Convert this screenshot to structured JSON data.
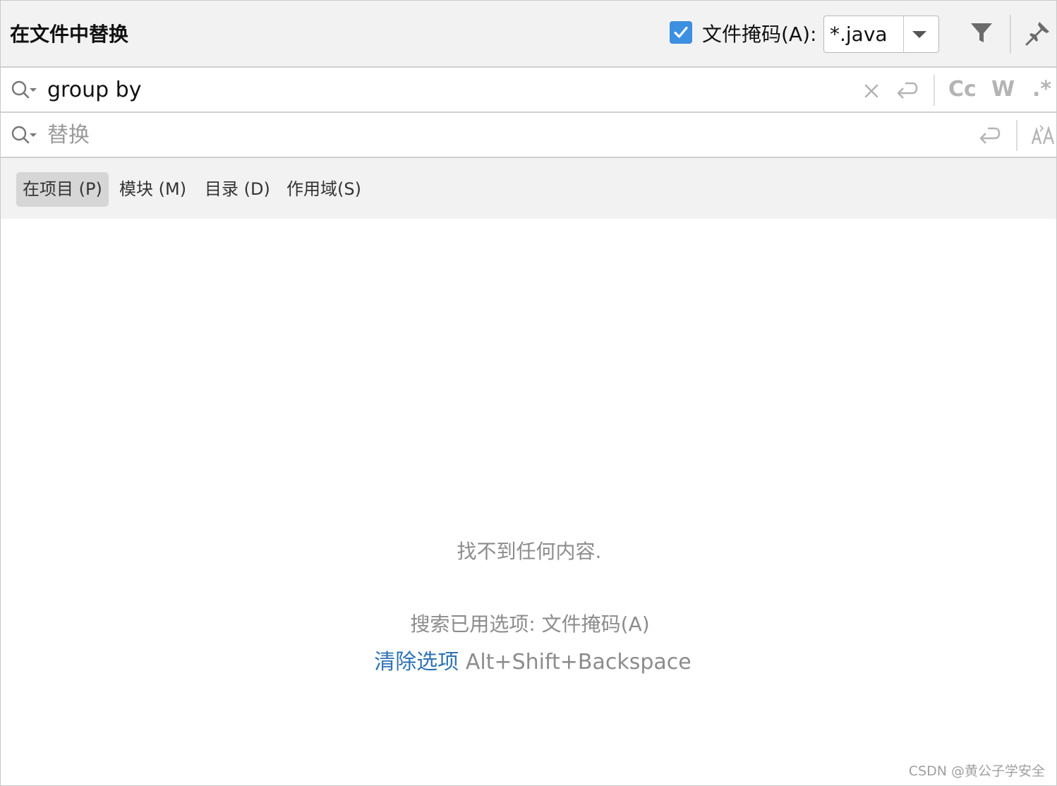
{
  "header": {
    "title": "在文件中替换",
    "file_mask_label": "文件掩码(A):",
    "file_mask_checked": true,
    "file_mask_value": "*.java",
    "icons": [
      "filter-icon",
      "pin-icon"
    ]
  },
  "search": {
    "value": "group by",
    "icons": [
      "magnifier-history-icon",
      "clear-icon",
      "newline-icon"
    ],
    "options": {
      "match_case": "Cc",
      "words": "W",
      "regex": ".*"
    }
  },
  "replace": {
    "placeholder": "替换",
    "icons": [
      "magnifier-history-icon",
      "newline-icon",
      "preserve-case-icon"
    ]
  },
  "scope_tabs": [
    {
      "label": "在项目 (P)",
      "selected": true
    },
    {
      "label": "模块 (M)",
      "selected": false
    },
    {
      "label": "目录 (D)",
      "selected": false
    },
    {
      "label": "作用域(S)",
      "selected": false
    }
  ],
  "empty_state": {
    "message": "找不到任何内容.",
    "options_used": "搜索已用选项: 文件掩码(A)",
    "clear_link": "清除选项",
    "clear_shortcut": "Alt+Shift+Backspace"
  },
  "watermark": "CSDN @黄公子学安全",
  "colors": {
    "accent": "#3d8fe0",
    "link": "#2f73b5",
    "muted": "#8c8c8c",
    "panel": "#f2f2f2"
  }
}
